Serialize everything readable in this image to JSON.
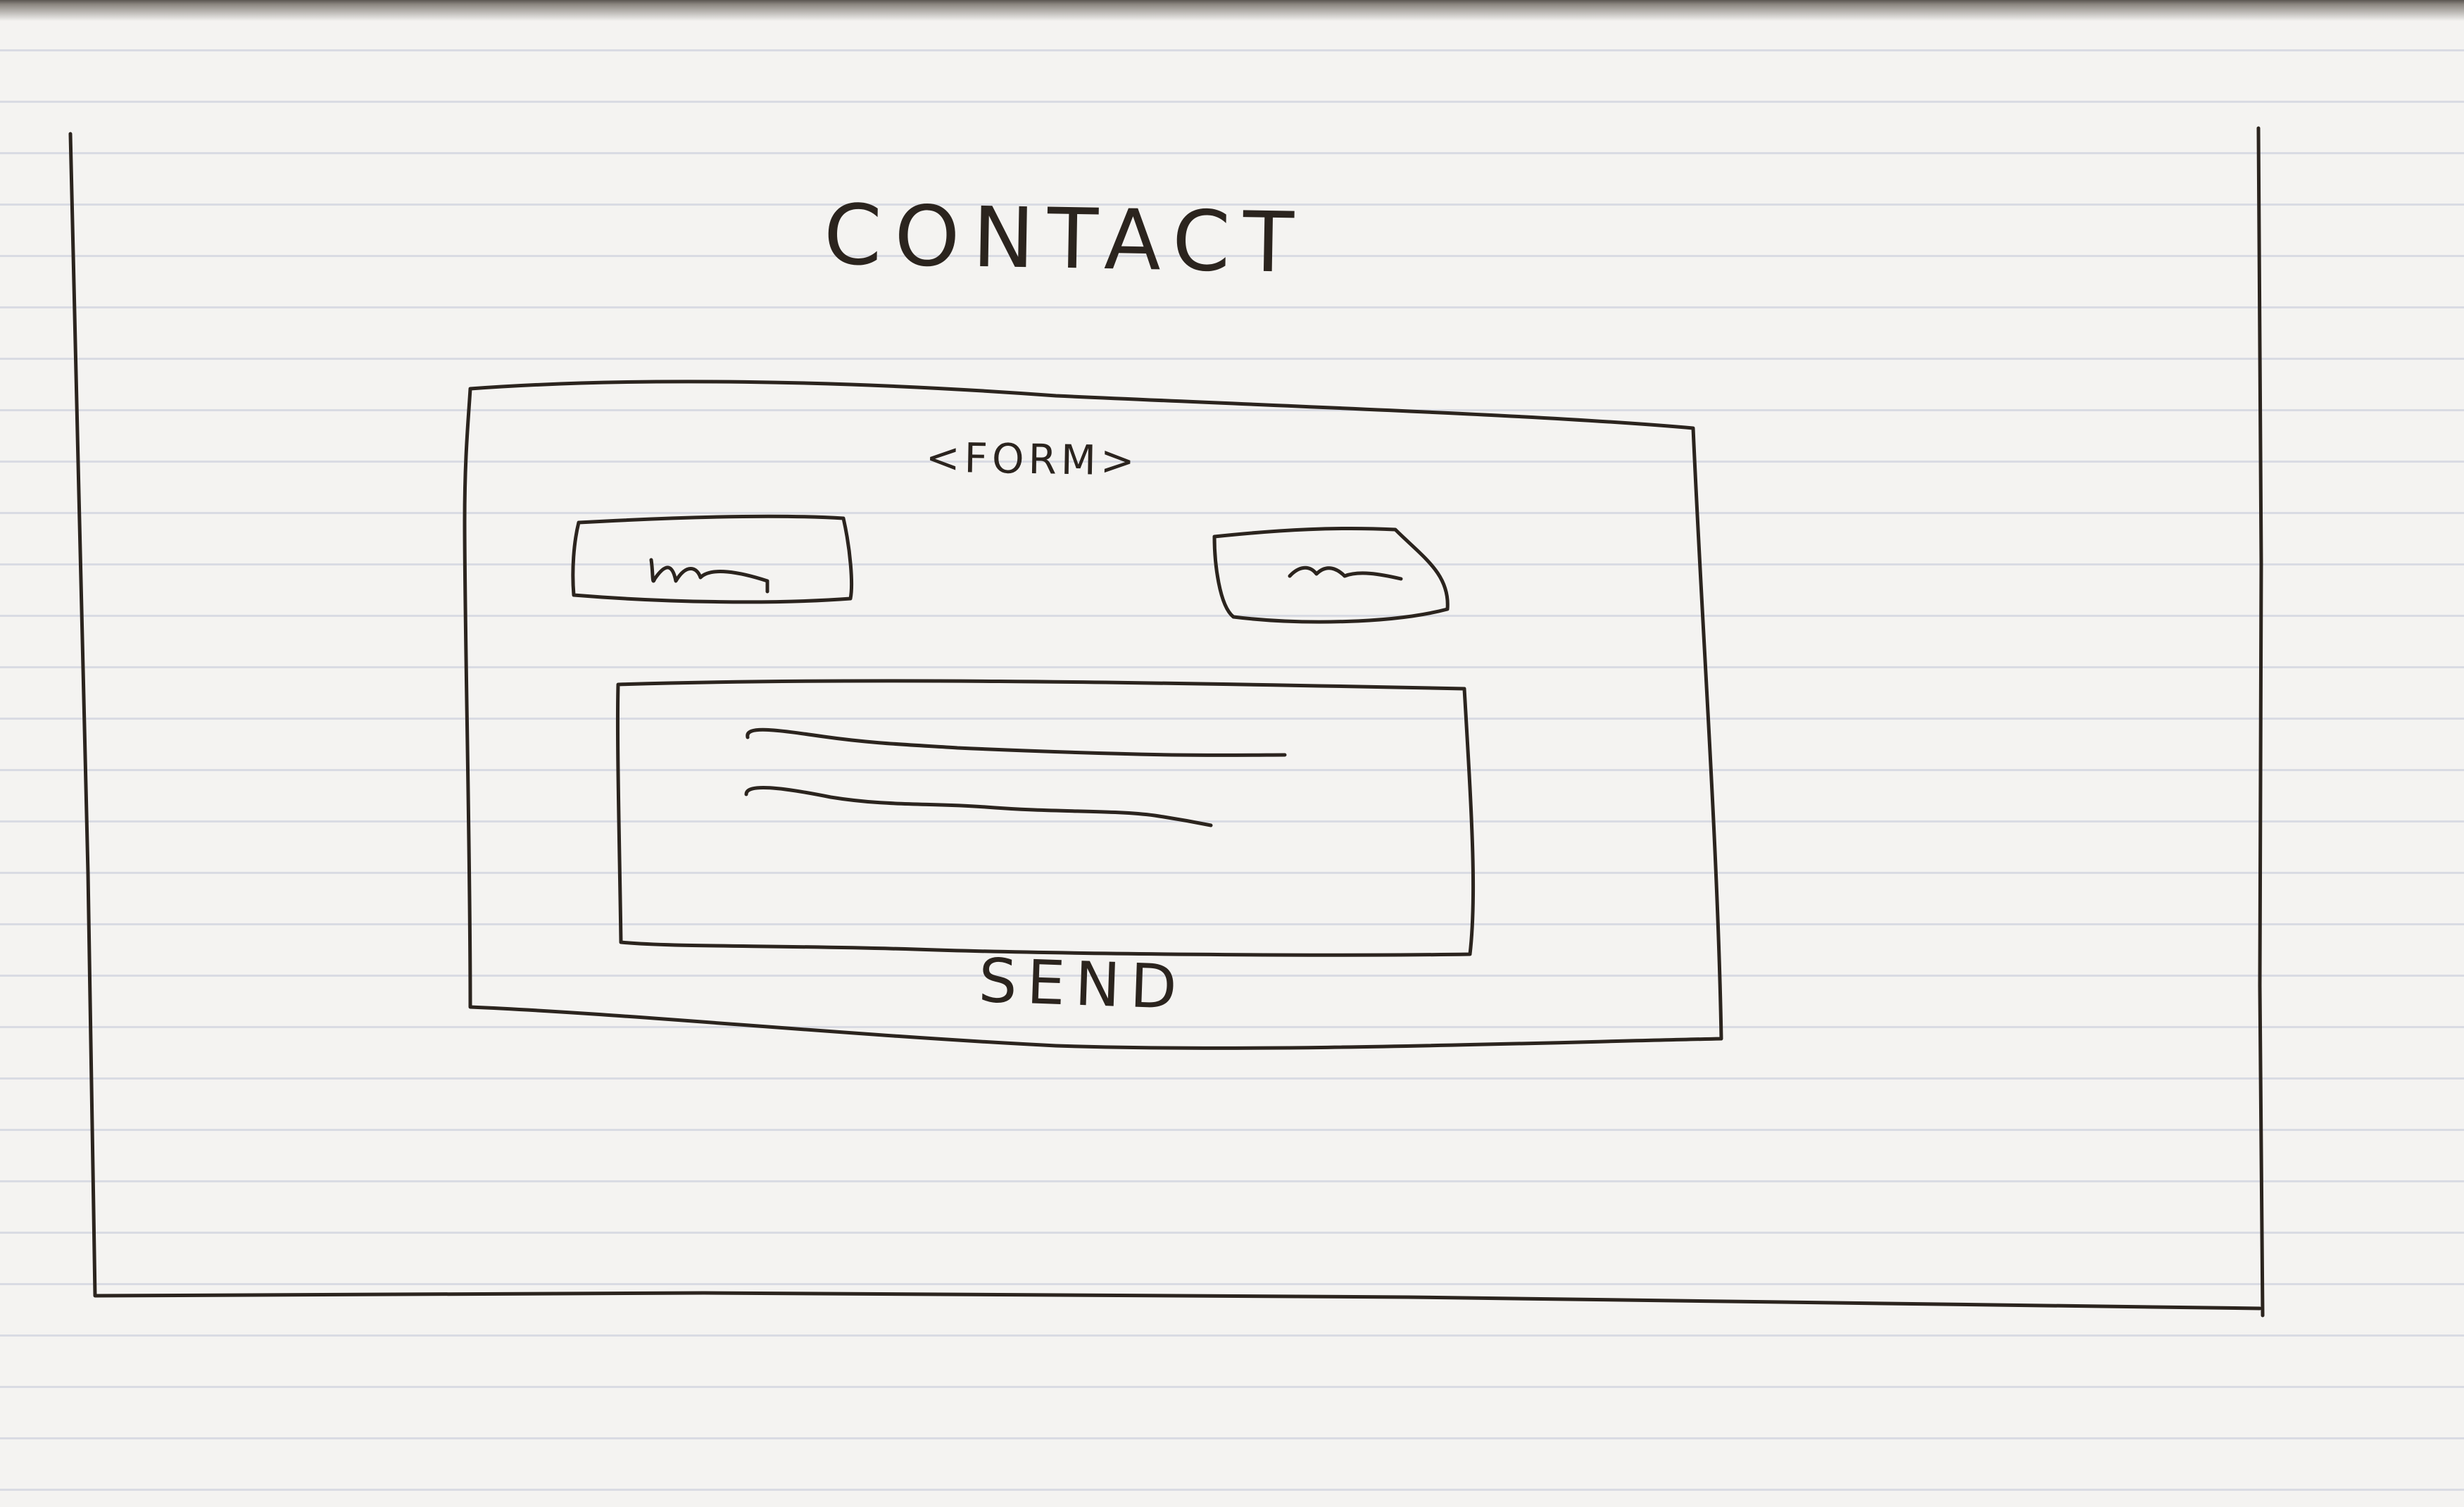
{
  "page": {
    "title": "CONTACT"
  },
  "form": {
    "label": "<FORM>",
    "send_label": "SEND"
  }
}
